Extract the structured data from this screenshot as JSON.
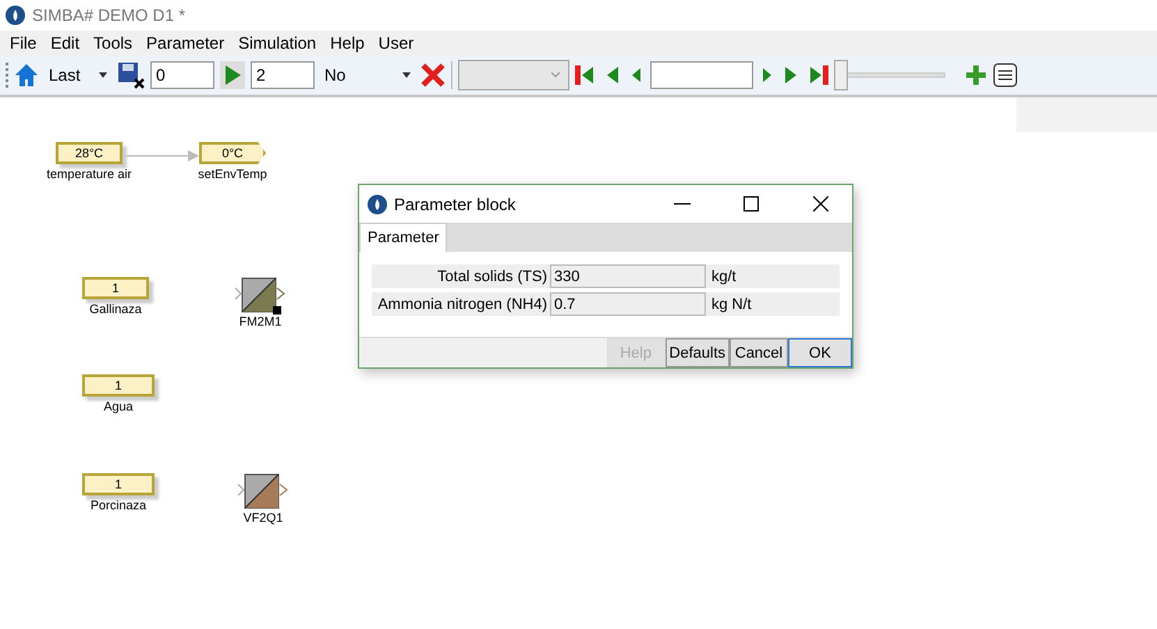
{
  "window": {
    "title": "SIMBA# DEMO D1 *"
  },
  "menu": [
    "File",
    "Edit",
    "Tools",
    "Parameter",
    "Simulation",
    "Help",
    "User"
  ],
  "toolbar": {
    "scenario": "Last",
    "start": "0",
    "end": "2",
    "option": "No",
    "slider": {
      "level": 0
    }
  },
  "blocks": [
    {
      "kind": "source",
      "value": "28°C",
      "label": "temperature air"
    },
    {
      "kind": "goto",
      "value": "0°C",
      "label": "setEnvTemp"
    },
    {
      "kind": "source",
      "value": "1",
      "label": "Gallinaza"
    },
    {
      "kind": "converter",
      "label": "FM2M1",
      "color": "#7b7a4e",
      "marker": true
    },
    {
      "kind": "source",
      "value": "1",
      "label": "Agua"
    },
    {
      "kind": "source",
      "value": "1",
      "label": "Porcinaza"
    },
    {
      "kind": "converter",
      "label": "VF2Q1",
      "color": "#a67c58",
      "marker": false
    }
  ],
  "dialog": {
    "title": "Parameter block",
    "tabs": [
      {
        "label": "Parameter",
        "selected": true
      }
    ],
    "rows": [
      {
        "label": "Total solids (TS)",
        "value": "330",
        "unit": "kg/t"
      },
      {
        "label": "Ammonia nitrogen (NH4)",
        "value": "0.7",
        "unit": "kg N/t"
      }
    ],
    "buttons": [
      {
        "label": "Help",
        "disabled": true,
        "default": false
      },
      {
        "label": "Defaults",
        "disabled": false,
        "default": false
      },
      {
        "label": "Cancel",
        "disabled": false,
        "default": false
      },
      {
        "label": "OK",
        "disabled": false,
        "default": true
      }
    ]
  }
}
